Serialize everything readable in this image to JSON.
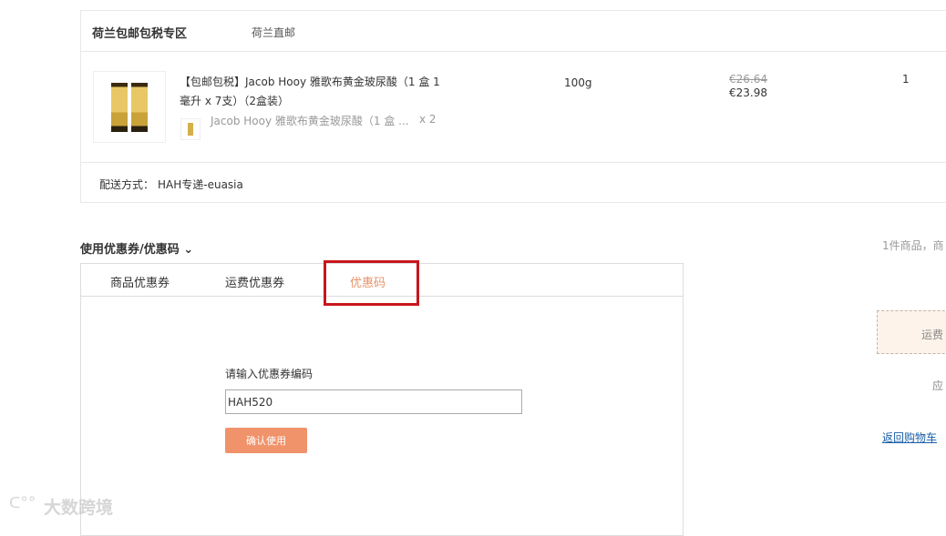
{
  "store": {
    "name": "荷兰包邮包税专区",
    "tag": "荷兰直邮"
  },
  "product": {
    "title_line1": "【包邮包税】Jacob Hooy 雅歌布黄金玻尿酸（1 盒 1",
    "title_line2": "毫升 x 7支）（2盒装）",
    "sub_item": "Jacob Hooy 雅歌布黄金玻尿酸（1 盒 ...",
    "sub_qty": "x 2",
    "weight": "100g",
    "original_price": "€26.64",
    "price": "€23.98",
    "quantity": "1"
  },
  "shipping": {
    "label": "配送方式：",
    "value": "HAH专递-euasia"
  },
  "coupon": {
    "title": "使用优惠券/优惠码",
    "tabs": [
      {
        "label": "商品优惠券"
      },
      {
        "label": "运费优惠券"
      },
      {
        "label": "优惠码"
      }
    ],
    "input_label": "请输入优惠券编码",
    "input_value": "HAH520",
    "confirm_label": "确认使用"
  },
  "summary": {
    "count_text": "1件商品，商",
    "fee_text": "运费",
    "due_text": "应",
    "back_link": "返回购物车"
  },
  "watermark": "大数跨境",
  "colors": {
    "accent": "#f0926a",
    "highlight": "#c8161d",
    "active_tab": "#e8916a"
  }
}
